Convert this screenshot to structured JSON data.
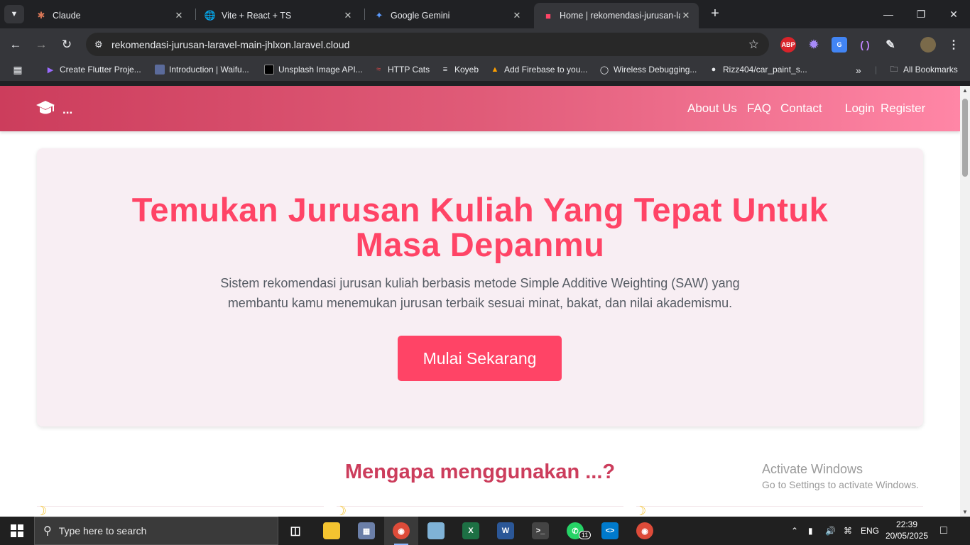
{
  "browser": {
    "tabs": [
      {
        "title": "Claude",
        "icon": "claude-icon"
      },
      {
        "title": "Vite + React + TS",
        "icon": "globe-icon"
      },
      {
        "title": "Google Gemini",
        "icon": "gemini-icon"
      },
      {
        "title": "Home | rekomendasi-jurusan-la",
        "icon": "site-icon",
        "active": true
      }
    ],
    "url": "rekomendasi-jurusan-laravel-main-jhlxon.laravel.cloud",
    "bookmarks": [
      {
        "label": "Create Flutter Proje...",
        "icon": "project-icon"
      },
      {
        "label": "Introduction | Waifu...",
        "icon": "waifu-icon"
      },
      {
        "label": "Unsplash Image API...",
        "icon": "unsplash-icon"
      },
      {
        "label": "HTTP Cats",
        "icon": "cat-icon"
      },
      {
        "label": "Koyeb",
        "icon": "koyeb-icon"
      },
      {
        "label": "Add Firebase to you...",
        "icon": "firebase-icon"
      },
      {
        "label": "Wireless Debugging...",
        "icon": "debug-icon"
      },
      {
        "label": "Rizz404/car_paint_s...",
        "icon": "github-icon"
      }
    ],
    "all_bookmarks_label": "All Bookmarks",
    "extensions": [
      "ABP"
    ]
  },
  "site": {
    "brand_text": "...",
    "nav": {
      "about": "About Us",
      "faq": "FAQ",
      "contact": "Contact",
      "login": "Login",
      "register": "Register"
    },
    "hero": {
      "title_line1": "Temukan Jurusan Kuliah Yang Tepat Untuk",
      "title_line2": "Masa Depanmu",
      "subtitle_line1": "Sistem rekomendasi jurusan kuliah berbasis metode Simple Additive Weighting (SAW) yang",
      "subtitle_line2": "membantu kamu menemukan jurusan terbaik sesuai minat, bakat, dan nilai akademismu.",
      "cta": "Mulai Sekarang"
    },
    "why_title": "Mengapa menggunakan ...?",
    "colors": {
      "accent": "#ff4466",
      "brand_dark": "#cc3d5c",
      "hero_bg": "#f8eef3"
    }
  },
  "watermark": {
    "line1": "Activate Windows",
    "line2": "Go to Settings to activate Windows."
  },
  "taskbar": {
    "search_placeholder": "Type here to search",
    "language": "ENG",
    "time": "22:39",
    "date": "20/05/2025",
    "whatsapp_badge": "11"
  }
}
